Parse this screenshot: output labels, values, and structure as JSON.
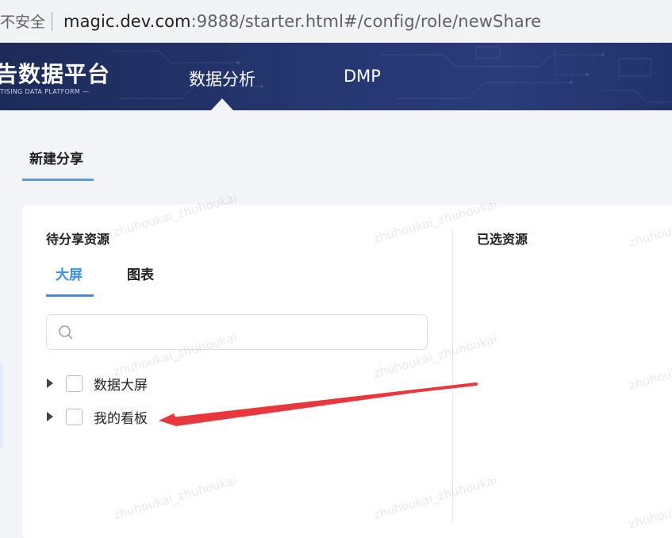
{
  "browser": {
    "insecure_label": "不安全",
    "url_host": "magic.dev.com",
    "url_rest": ":9888/starter.html#/config/role/newShare"
  },
  "header": {
    "logo_text": "告数据平台",
    "logo_subtext": "TISING DATA PLATFORM —",
    "nav": [
      {
        "label": "数据分析",
        "active": true
      },
      {
        "label": "DMP",
        "active": false
      }
    ]
  },
  "page": {
    "tab_label": "新建分享"
  },
  "panel_left": {
    "title": "待分享资源",
    "tabs": [
      {
        "label": "大屏",
        "active": true
      },
      {
        "label": "图表",
        "active": false
      }
    ],
    "search": {
      "value": "",
      "placeholder": ""
    },
    "tree": [
      {
        "label": "数据大屏",
        "checked": false
      },
      {
        "label": "我的看板",
        "checked": false
      }
    ]
  },
  "panel_right": {
    "title": "已选资源"
  },
  "watermark_text": "zhuhoukai_zhuhoukai",
  "colors": {
    "accent": "#3a8ee6",
    "header_bg": "#253670",
    "annotation_arrow": "#e8383d"
  }
}
